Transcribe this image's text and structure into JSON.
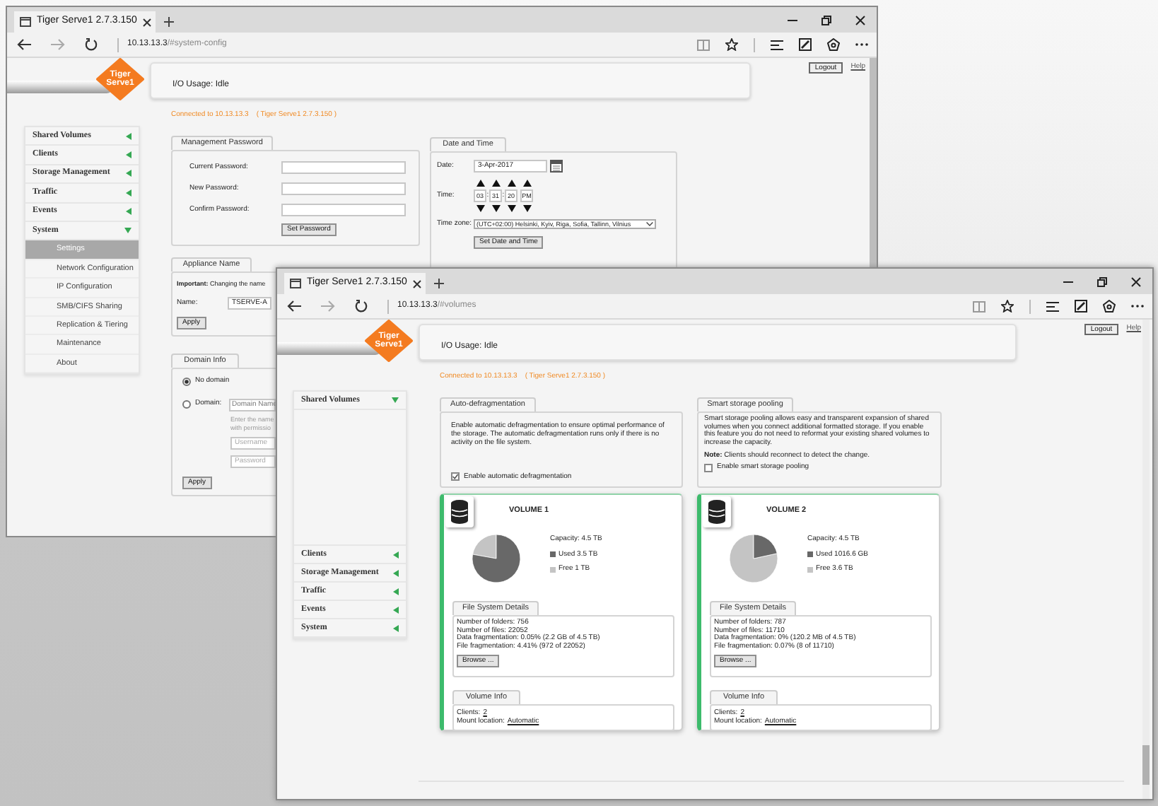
{
  "back_window": {
    "tab_title": "Tiger Serve1 2.7.3.150",
    "address": {
      "host": "10.13.13.3",
      "path": "/#system-config"
    },
    "logo": [
      "Tiger",
      "Serve1"
    ],
    "io_usage": "I/O Usage: Idle",
    "logout": "Logout",
    "help": "Help",
    "connected": "Connected to 10.13.13.3    ( Tiger Serve1 2.7.3.150 )",
    "sidebar": [
      {
        "label": "Shared Volumes",
        "expanded": false
      },
      {
        "label": "Clients",
        "expanded": false
      },
      {
        "label": "Storage Management",
        "expanded": false
      },
      {
        "label": "Traffic",
        "expanded": false
      },
      {
        "label": "Events",
        "expanded": false
      },
      {
        "label": "System",
        "expanded": true,
        "children": [
          {
            "label": "Settings",
            "selected": true
          },
          {
            "label": "Network Configuration",
            "selected": false
          },
          {
            "label": "IP Configuration",
            "selected": false
          },
          {
            "label": "SMB/CIFS Sharing",
            "selected": false
          },
          {
            "label": "Replication & Tiering",
            "selected": false
          },
          {
            "label": "Maintenance",
            "selected": false
          },
          {
            "label": "About",
            "selected": false
          }
        ]
      }
    ],
    "management_password": {
      "title": "Management Password",
      "fields": [
        {
          "label": "Current Password:"
        },
        {
          "label": "New Password:"
        },
        {
          "label": "Confirm Password:"
        }
      ],
      "button": "Set Password"
    },
    "date_time": {
      "title": "Date and Time",
      "date_label": "Date:",
      "date": "3-Apr-2017",
      "time_label": "Time:",
      "time": [
        "03",
        "31",
        "20",
        "PM"
      ],
      "separator": ":",
      "timezone_label": "Time zone:",
      "timezone": "(UTC+02:00) Helsinki, Kyiv, Riga, Sofia, Tallinn, Vilnius",
      "button": "Set Date and Time"
    },
    "appliance_name": {
      "title": "Appliance Name",
      "note": "**Important:** Changing the name",
      "name_label": "Name:",
      "name": "TSERVE-A",
      "button": "Apply"
    },
    "domain_info": {
      "title": "Domain Info",
      "options": [
        {
          "label": "No domain",
          "selected": true
        },
        {
          "label": "Domain:",
          "selected": false
        }
      ],
      "domain_placeholder": "Domain Name",
      "hint": [
        "Enter the name",
        "with permissio"
      ],
      "username_placeholder": "Username",
      "password_placeholder": "Password",
      "button": "Apply"
    }
  },
  "front_window": {
    "tab_title": "Tiger Serve1 2.7.3.150",
    "address": {
      "host": "10.13.13.3",
      "path": "/#volumes"
    },
    "logo": [
      "Tiger",
      "Serve1"
    ],
    "io_usage": "I/O Usage: Idle",
    "logout": "Logout",
    "help": "Help",
    "connected": "Connected to 10.13.13.3    ( Tiger Serve1 2.7.3.150 )",
    "sidebar": [
      {
        "label": "Shared Volumes",
        "expanded": true
      },
      {
        "label": "Clients",
        "expanded": false
      },
      {
        "label": "Storage Management",
        "expanded": false
      },
      {
        "label": "Traffic",
        "expanded": false
      },
      {
        "label": "Events",
        "expanded": false
      },
      {
        "label": "System",
        "expanded": false
      }
    ],
    "auto_defragmentation": {
      "title": "Auto-defragmentation",
      "description": "Enable automatic defragmentation to ensure optimal performance of the storage. The automatic defragmentation runs only if there is no activity on the file system.",
      "checkbox": {
        "label": "Enable automatic defragmentation",
        "checked": true
      }
    },
    "smart_storage_pooling": {
      "title": "Smart storage pooling",
      "description": "Smart storage pooling allows easy and transparent expansion of shared volumes when you connect additional formatted storage. If you enable this feature you do not need to reformat your existing shared volumes to increase the capacity.",
      "note": "**Note:** Clients should reconnect to detect the change.",
      "checkbox": {
        "label": "Enable smart storage pooling",
        "checked": false
      }
    },
    "volumes": [
      {
        "name": "VOLUME 1",
        "capacity": "Capacity: 4.5 TB",
        "chart_data": {
          "type": "pie",
          "categories": [
            "Used 3.5 TB",
            "Free 1 TB"
          ],
          "values": [
            77.8,
            22.2
          ]
        },
        "details_title": "File System Details",
        "details": [
          "Number of folders: 756",
          "Number of files: 22052",
          "Data fragmentation: 0.05% (2.2 GB of 4.5 TB)",
          "File fragmentation: 4.41% (972 of 22052)"
        ],
        "browse": "Browse ...",
        "info_title": "Volume Info",
        "clients_label": "Clients:",
        "clients": "2",
        "mount_label": "Mount location:",
        "mount": "Automatic"
      },
      {
        "name": "VOLUME 2",
        "capacity": "Capacity: 4.5 TB",
        "chart_data": {
          "type": "pie",
          "categories": [
            "Used 1016.6 GB",
            "Free 3.6 TB"
          ],
          "values": [
            21.6,
            78.4
          ]
        },
        "details_title": "File System Details",
        "details": [
          "Number of folders: 787",
          "Number of files: 11710",
          "Data fragmentation: 0% (120.2 MB of 4.5 TB)",
          "File fragmentation: 0.07% (8 of 11710)"
        ],
        "browse": "Browse ...",
        "info_title": "Volume Info",
        "clients_label": "Clients:",
        "clients": "2",
        "mount_label": "Mount location:",
        "mount": "Automatic"
      }
    ]
  }
}
